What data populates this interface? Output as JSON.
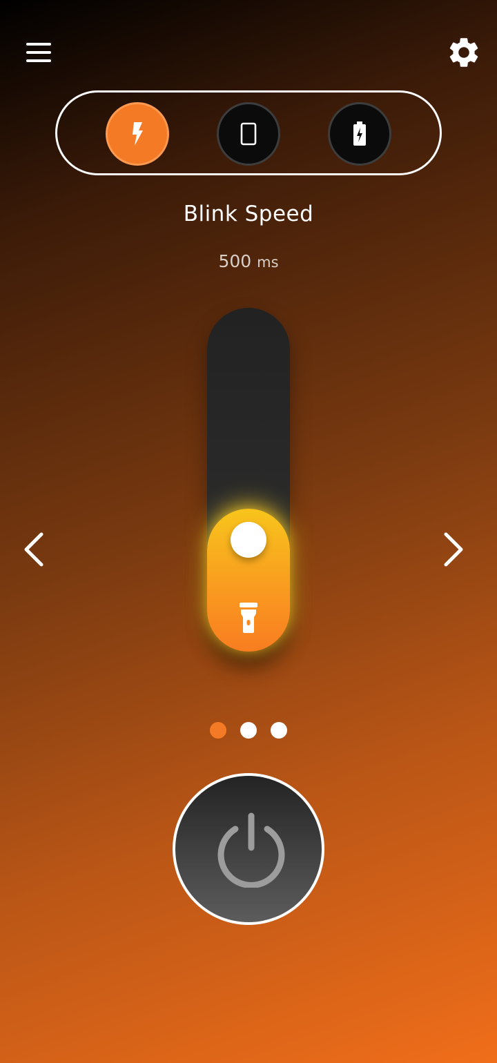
{
  "app": {
    "icons": {
      "menu": "menu-icon",
      "settings": "gear-icon"
    }
  },
  "modes": [
    {
      "icon": "lightning-icon",
      "active": true
    },
    {
      "icon": "phone-screen-icon",
      "active": false
    },
    {
      "icon": "battery-charging-icon",
      "active": false
    }
  ],
  "blink": {
    "title": "Blink Speed",
    "value": "500",
    "unit": "ms",
    "level": 0.42
  },
  "navigation": {
    "prev_icon": "chevron-left-icon",
    "next_icon": "chevron-right-icon"
  },
  "pagination": {
    "total": 3,
    "current": 1
  },
  "power": {
    "icon": "power-icon"
  },
  "colors": {
    "accent": "#f57a25",
    "slider_top": "#f8c51c",
    "slider_bottom": "#f97d20",
    "track": "#2a2a2a"
  }
}
